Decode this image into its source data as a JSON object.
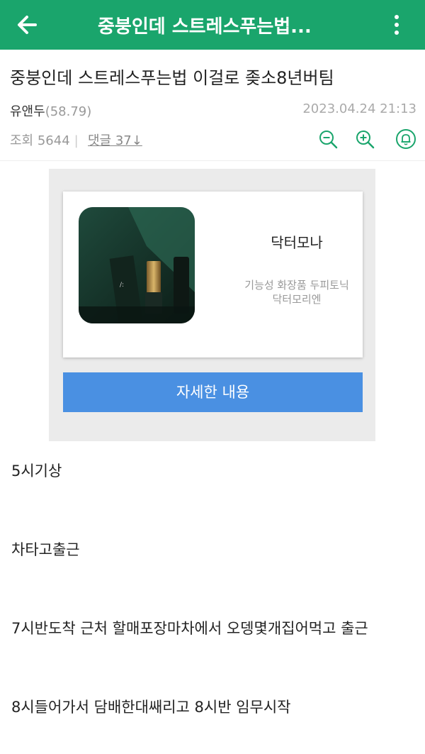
{
  "appbar": {
    "title": "중붕인데 스트레스푸는법...",
    "bg_color": "#1aa56c",
    "back_icon": "arrow-left-icon",
    "more_icon": "more-vertical-icon"
  },
  "post": {
    "title": "중붕인데 스트레스푸는법 이걸로 좆소8년버팀",
    "author": "유앤두",
    "author_score": "(58.79)",
    "date": "2023.04.24 21:13",
    "views_label": "조회 5644",
    "comments_label": "댓글 37↓",
    "tool_icons": [
      "zoom-out-icon",
      "zoom-in-icon",
      "bell-icon"
    ],
    "tool_color": "#1aa56c"
  },
  "ad": {
    "brand": "닥터모나",
    "desc_line1": "기능성 화장품 두피토닉",
    "desc_line2": "닥터모리엔",
    "button_label": "자세한 내용",
    "button_color": "#4a90e2"
  },
  "content": {
    "lines": [
      "5시기상",
      "차타고출근",
      "7시반도착 근처 할매포장마차에서 오뎅몇개집어먹고 출근",
      "8시들어가서 담배한대쌔리고 8시반 임무시작"
    ]
  }
}
